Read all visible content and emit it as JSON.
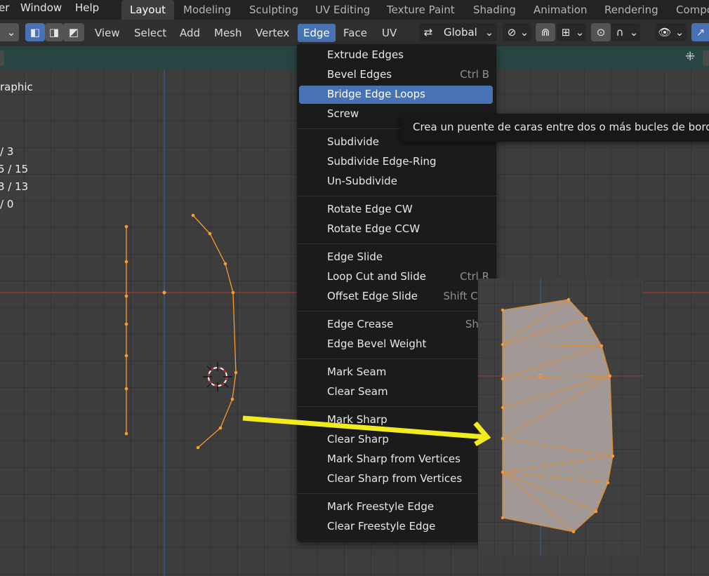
{
  "topbar": {
    "menus": [
      "er",
      "Window",
      "Help"
    ],
    "tabs": [
      "Layout",
      "Modeling",
      "Sculpting",
      "UV Editing",
      "Texture Paint",
      "Shading",
      "Animation",
      "Rendering",
      "Compo"
    ],
    "active_tab": "Layout"
  },
  "header": {
    "menus": [
      "View",
      "Select",
      "Add",
      "Mesh",
      "Vertex",
      "Edge",
      "Face",
      "UV"
    ],
    "active_menu": "Edge",
    "transform_orientation": "Global"
  },
  "viewport": {
    "view_label": "raphic",
    "stats": [
      "/ 3",
      "5 / 15",
      "3 / 13",
      "/ 0"
    ]
  },
  "edge_menu": {
    "groups": [
      [
        {
          "label": "Extrude Edges",
          "shortcut": ""
        },
        {
          "label": "Bevel Edges",
          "shortcut": "Ctrl B"
        },
        {
          "label": "Bridge Edge Loops",
          "shortcut": ""
        },
        {
          "label": "Screw",
          "shortcut": ""
        }
      ],
      [
        {
          "label": "Subdivide",
          "shortcut": ""
        },
        {
          "label": "Subdivide Edge-Ring",
          "shortcut": ""
        },
        {
          "label": "Un-Subdivide",
          "shortcut": ""
        }
      ],
      [
        {
          "label": "Rotate Edge CW",
          "shortcut": ""
        },
        {
          "label": "Rotate Edge CCW",
          "shortcut": ""
        }
      ],
      [
        {
          "label": "Edge Slide",
          "shortcut": ""
        },
        {
          "label": "Loop Cut and Slide",
          "shortcut": "Ctrl R"
        },
        {
          "label": "Offset Edge Slide",
          "shortcut": "Shift Ctrl"
        }
      ],
      [
        {
          "label": "Edge Crease",
          "shortcut": "Shift"
        },
        {
          "label": "Edge Bevel Weight",
          "shortcut": ""
        }
      ],
      [
        {
          "label": "Mark Seam",
          "shortcut": ""
        },
        {
          "label": "Clear Seam",
          "shortcut": ""
        }
      ],
      [
        {
          "label": "Mark Sharp",
          "shortcut": ""
        },
        {
          "label": "Clear Sharp",
          "shortcut": ""
        },
        {
          "label": "Mark Sharp from Vertices",
          "shortcut": ""
        },
        {
          "label": "Clear Sharp from Vertices",
          "shortcut": ""
        }
      ],
      [
        {
          "label": "Mark Freestyle Edge",
          "shortcut": ""
        },
        {
          "label": "Clear Freestyle Edge",
          "shortcut": ""
        }
      ]
    ],
    "highlighted": "Bridge Edge Loops"
  },
  "tooltip": {
    "text": "Crea un puente de caras entre dos o más bucles de bordes"
  },
  "colors": {
    "accent": "#4772b3",
    "mesh": "#ff9a2e",
    "arrow": "#f2ec1f",
    "toolstrip": "#284544"
  }
}
